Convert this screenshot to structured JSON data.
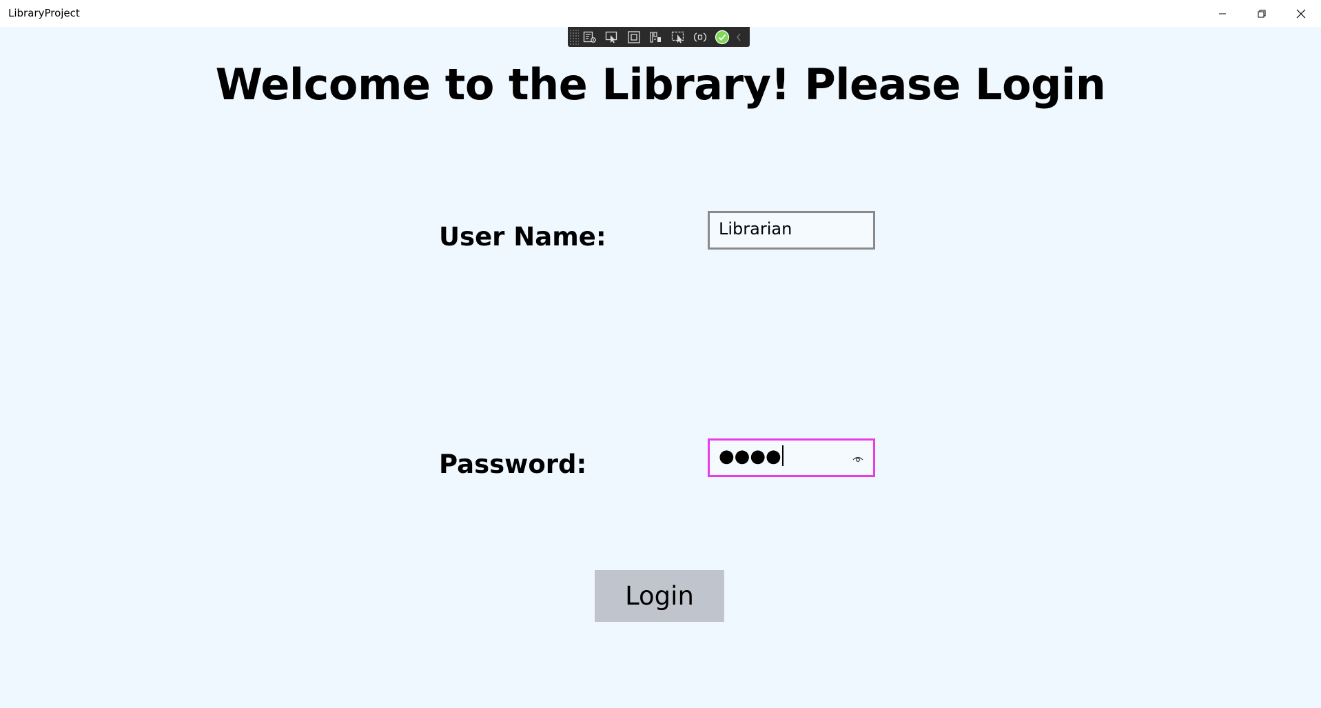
{
  "window": {
    "title": "LibraryProject",
    "controls": {
      "minimize_icon": "minimize-icon",
      "maximize_icon": "restore-icon",
      "close_icon": "close-icon"
    }
  },
  "debug_toolbar": {
    "icons": [
      "live-visual-tree-icon",
      "select-element-icon",
      "display-layout-adorners-icon",
      "track-focus-icon",
      "hot-reload-preview-icon",
      "binding-failures-icon",
      "accessibility-check-icon"
    ],
    "accent": "#7ED957"
  },
  "main": {
    "heading": "Welcome to the Library! Please Login",
    "username": {
      "label": "User Name:",
      "value": "Librarian"
    },
    "password": {
      "label": "Password:",
      "masked_value": "●●●●",
      "focus_border_color": "#E83CE8"
    },
    "login_button": {
      "label": "Login",
      "background": "#C0C4CC"
    },
    "background": "#F0F8FF"
  }
}
